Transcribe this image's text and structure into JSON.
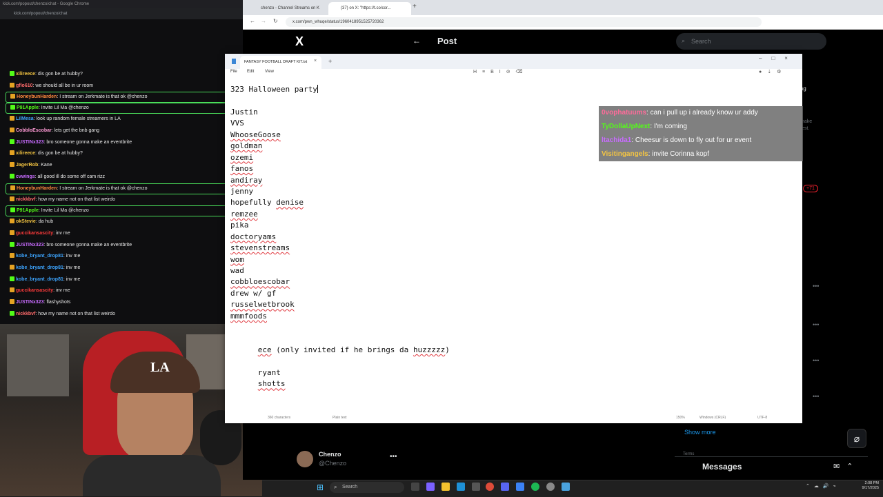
{
  "chat_window": {
    "title": "kick.com/popout/chenzo/chat - Google Chrome",
    "url": "kick.com/popout/chenzo/chat",
    "messages": [
      {
        "user": "xilireece",
        "text": "dis gon be at hubby?",
        "color": "#f4c542",
        "highlight": false
      },
      {
        "user": "gflo610",
        "text": "we should all be in ur room",
        "color": "#ff6b6b",
        "highlight": false
      },
      {
        "user": "HoneybunHarden",
        "text": "I stream on Jerkmate is that ok @chenzo",
        "color": "#ff8a3d",
        "highlight": true
      },
      {
        "user": "P91Apple",
        "text": "Invite Lil Ma @chenzo",
        "color": "#53fc18",
        "highlight": true
      },
      {
        "user": "LilMesa",
        "text": "look up random female streamers in LA",
        "color": "#3da5ff",
        "highlight": false
      },
      {
        "user": "CobbloEscobar",
        "text": "lets get the bnb gang",
        "color": "#ff9ad5",
        "highlight": false
      },
      {
        "user": "JUSTINx323",
        "text": "bro someone gonna make an eventbrite",
        "color": "#c86cff",
        "highlight": false
      },
      {
        "user": "xilireece",
        "text": "dis gon be at hubby?",
        "color": "#f4c542",
        "highlight": false
      },
      {
        "user": "JagerRob",
        "text": "Kane",
        "color": "#f4c542",
        "highlight": false
      },
      {
        "user": "cvwings",
        "text": "all good ill do some off cam rizz",
        "color": "#c86cff",
        "highlight": false
      },
      {
        "user": "HoneybunHarden",
        "text": "I stream on Jerkmate is that ok @chenzo",
        "color": "#ff8a3d",
        "highlight": true
      },
      {
        "user": "nickkbvf",
        "text": "how my name not on that list weirdo",
        "color": "#ff6b6b",
        "highlight": false
      },
      {
        "user": "P91Apple",
        "text": "Invite Lil Ma @chenzo",
        "color": "#53fc18",
        "highlight": true
      },
      {
        "user": "okStevie",
        "text": "da hub",
        "color": "#f4c542",
        "highlight": false
      },
      {
        "user": "guccikansascity",
        "text": "inv me",
        "color": "#ff3b3b",
        "highlight": false
      },
      {
        "user": "JUSTINx323",
        "text": "bro someone gonna make an eventbrite",
        "color": "#c86cff",
        "highlight": false
      },
      {
        "user": "kobe_bryant_drop81",
        "text": "inv me",
        "color": "#3da5ff",
        "highlight": false
      },
      {
        "user": "kobe_bryant_drop81",
        "text": "inv me",
        "color": "#3da5ff",
        "highlight": false
      },
      {
        "user": "kobe_bryant_drop81",
        "text": "inv me",
        "color": "#3da5ff",
        "highlight": false
      },
      {
        "user": "guccikansascity",
        "text": "inv me",
        "color": "#ff3b3b",
        "highlight": false
      },
      {
        "user": "JUSTINx323",
        "text": "flashyshots",
        "color": "#c86cff",
        "highlight": false
      },
      {
        "user": "nickkbvf",
        "text": "how my name not on that list weirdo",
        "color": "#ff6b6b",
        "highlight": false
      }
    ]
  },
  "webcam": {
    "cap_logo": "LA"
  },
  "x_browser": {
    "tab1": "chenzo - Channel Streams on K",
    "tab2": "(37) on X: \"https://t.co/cor...",
    "url": "x.com/pwn_whuqe/status/1960418951525720362",
    "logo": "X",
    "back": "←",
    "post_title": "Post",
    "search_placeholder": "Search",
    "show_more": "Show more",
    "profile_name": "Chenzo",
    "profile_handle": "@Chenzo",
    "messages_label": "Messages",
    "ghost_text_1": "ing",
    "ghost_text_2": "make\ntest.",
    "ghost_badge": "+71",
    "terms": "Terms"
  },
  "notepad": {
    "tab_title": "FANTASY FOOTBALL DRAFT KIT.txt",
    "menu": {
      "file": "File",
      "edit": "Edit",
      "view": "View"
    },
    "lines": [
      {
        "text": "323 Halloween party",
        "squiggle": false,
        "caret": true
      },
      {
        "text": "",
        "squiggle": false
      },
      {
        "text": "Justin",
        "squiggle": false
      },
      {
        "text": "VVS",
        "squiggle": false
      },
      {
        "text": "WhooseGoose",
        "squiggle": true
      },
      {
        "text": "goldman",
        "squiggle": true
      },
      {
        "text": "ozemi",
        "squiggle": true
      },
      {
        "text": "fanos",
        "squiggle": true
      },
      {
        "text": "andiray",
        "squiggle": true
      },
      {
        "text": "jenny",
        "squiggle": false
      },
      {
        "pre": "hopefully ",
        "text": "denise",
        "squiggle": true
      },
      {
        "text": "remzee",
        "squiggle": true
      },
      {
        "text": "pika",
        "squiggle": false
      },
      {
        "text": "doctoryams",
        "squiggle": true
      },
      {
        "text": "stevenstreams",
        "squiggle": true
      },
      {
        "text": "wom",
        "squiggle": true
      },
      {
        "text": "wad",
        "squiggle": false
      },
      {
        "text": "cobbloescobar",
        "squiggle": true
      },
      {
        "text": "drew w/ gf",
        "squiggle": false
      },
      {
        "text": "russelwetbrook",
        "squiggle": true
      },
      {
        "text": "mmmfoods",
        "squiggle": true
      },
      {
        "text": "",
        "squiggle": false
      },
      {
        "text": "",
        "squiggle": false
      },
      {
        "pre": "      ",
        "text": "ece",
        "squiggle": true,
        "post": " (only invited if he brings da ",
        "post_sq": "huzzzzz",
        "tail": ")"
      },
      {
        "text": "",
        "squiggle": false
      },
      {
        "pre": "      ",
        "text": "ryant",
        "squiggle": false
      },
      {
        "pre": "      ",
        "text": "shotts",
        "squiggle": true
      }
    ],
    "status": {
      "chars": "360 characters",
      "plain": "Plain text",
      "zoom": "150%",
      "eol": "Windows (CRLF)",
      "encoding": "UTF-8"
    }
  },
  "overlay": [
    {
      "user": "0vophatuums",
      "text": ": can i pull up i already know ur addy",
      "color": "#ff6b9a"
    },
    {
      "user": "TyDollaUpNext",
      "text": ": I'm coming",
      "color": "#53fc18"
    },
    {
      "user": "ltachida1",
      "text": ": Cheesur is down to fly out for ur event",
      "color": "#c86cff"
    },
    {
      "user": "Visitingangels",
      "text": ": invite Corinna kopf",
      "color": "#f4c542"
    }
  ],
  "taskbar": {
    "search": "Search",
    "clock_time": "2:08 PM",
    "clock_date": "9/17/2025"
  }
}
